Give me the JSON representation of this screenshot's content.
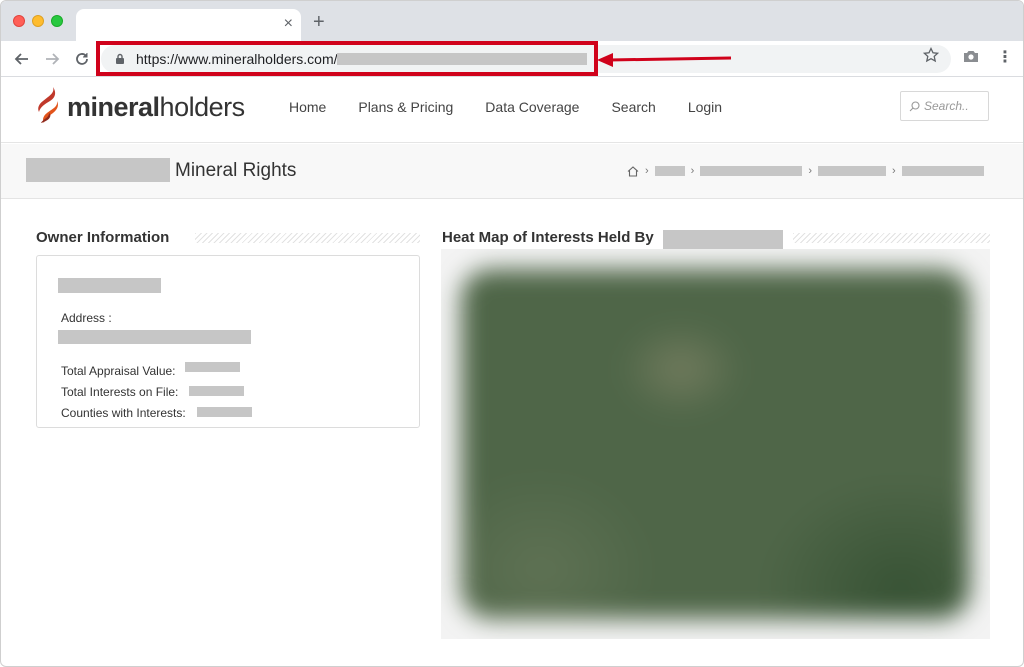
{
  "browser": {
    "tab_close": "×",
    "new_tab": "+",
    "url": "https://www.mineralholders.com/",
    "menu": "⋮"
  },
  "site": {
    "logo_bold": "mineral",
    "logo_light": "holders",
    "nav": [
      "Home",
      "Plans & Pricing",
      "Data Coverage",
      "Search",
      "Login"
    ],
    "search_placeholder": "Search.."
  },
  "page": {
    "title": "Mineral Rights"
  },
  "owner": {
    "section_title": "Owner Information",
    "address_label": "Address :",
    "appraisal_label": "Total Appraisal Value:",
    "interests_label": "Total Interests on File:",
    "counties_label": "Counties with Interests:"
  },
  "heatmap": {
    "section_title": "Heat Map of Interests Held By"
  },
  "colors": {
    "highlight": "#d0021b",
    "logo_accent": "#c0392b",
    "redaction": "#c6c6c6"
  }
}
